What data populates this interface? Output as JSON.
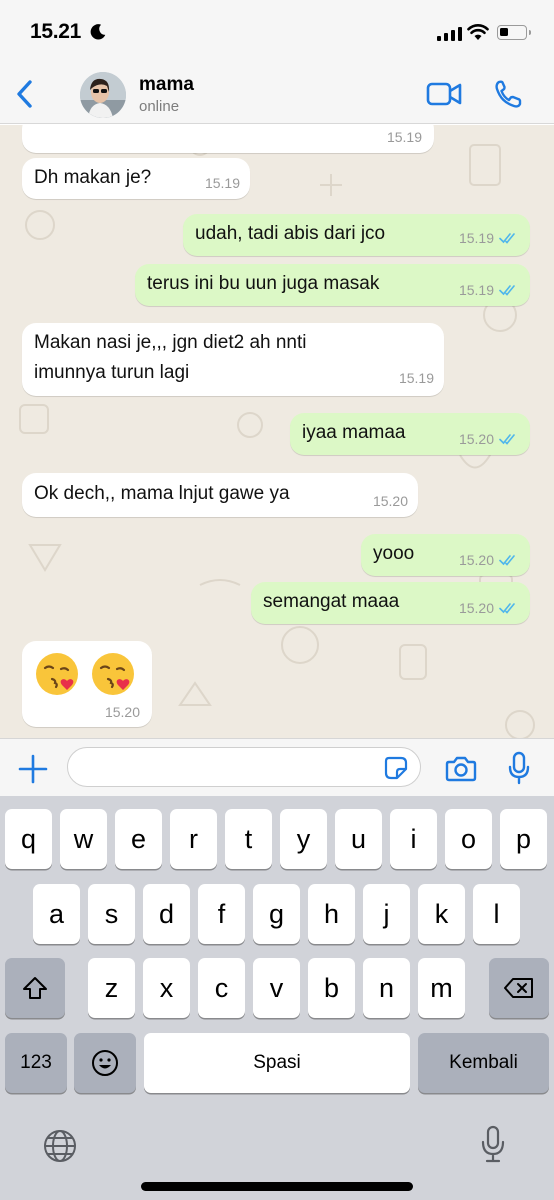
{
  "status_bar": {
    "time": "15.21",
    "dnd_icon": "moon-icon"
  },
  "header": {
    "back_icon": "chevron-left-icon",
    "contact_name": "mama",
    "contact_status": "online",
    "video_icon": "video-call-icon",
    "phone_icon": "phone-icon",
    "accent_color": "#1f7ae0"
  },
  "messages": [
    {
      "direction": "in",
      "text": "",
      "time": "15.19"
    },
    {
      "direction": "in",
      "text": "Dh makan je?",
      "time": "15.19"
    },
    {
      "direction": "out",
      "text": "udah, tadi abis dari jco",
      "time": "15.19",
      "read": true
    },
    {
      "direction": "out",
      "text": "terus ini bu uun juga masak",
      "time": "15.19",
      "read": true
    },
    {
      "direction": "in",
      "line1": "Makan nasi je,,, jgn diet2 ah nnti",
      "line2": "imunnya turun lagi",
      "time": "15.19"
    },
    {
      "direction": "out",
      "text": "iyaa mamaa",
      "time": "15.20",
      "read": true
    },
    {
      "direction": "in",
      "text": "Ok dech,, mama lnjut gawe ya",
      "time": "15.20"
    },
    {
      "direction": "out",
      "text": "yooo",
      "time": "15.20",
      "read": true
    },
    {
      "direction": "out",
      "text": "semangat maaa",
      "time": "15.20",
      "read": true
    },
    {
      "direction": "in",
      "emoji": "kissing-heart-emoji x2",
      "time": "15.20"
    }
  ],
  "bubble_colors": {
    "incoming": "#ffffff",
    "outgoing": "#dcf8c6",
    "read_ticks": "#4fb6ec"
  },
  "input_bar": {
    "value": "",
    "placeholder": ""
  },
  "keyboard": {
    "row1": [
      "q",
      "w",
      "e",
      "r",
      "t",
      "y",
      "u",
      "i",
      "o",
      "p"
    ],
    "row2": [
      "a",
      "s",
      "d",
      "f",
      "g",
      "h",
      "j",
      "k",
      "l"
    ],
    "row3": [
      "z",
      "x",
      "c",
      "v",
      "b",
      "n",
      "m"
    ],
    "numbers_key": "123",
    "space_key": "Spasi",
    "return_key": "Kembali"
  }
}
